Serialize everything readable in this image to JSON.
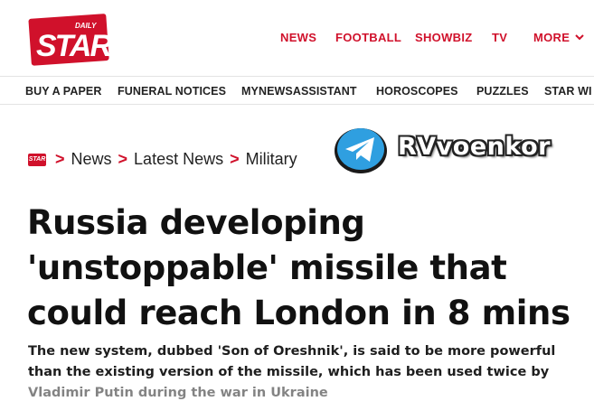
{
  "brand": {
    "logo_top": "DAILY",
    "logo_main": "STAR",
    "accent": "#d0112b"
  },
  "main_nav": {
    "news": "NEWS",
    "football": "FOOTBALL",
    "showbiz": "SHOWBIZ",
    "tv": "TV",
    "more": "MORE"
  },
  "sub_nav": [
    "BUY A PAPER",
    "FUNERAL NOTICES",
    "MYNEWSASSISTANT",
    "HOROSCOPES",
    "PUZZLES",
    "STAR WI"
  ],
  "breadcrumb": {
    "items": [
      "News",
      "Latest News",
      "Military"
    ],
    "separator": ">"
  },
  "watermark": {
    "icon": "telegram-icon",
    "label": "RVvoenkor"
  },
  "article": {
    "headline_lines": [
      "Russia developing",
      "'unstoppable' missile that",
      "could reach London in 8 mins"
    ],
    "standfirst_lines": [
      "The new system, dubbed 'Son of Oreshnik', is said to be more powerful",
      "than the existing version of the missile, which has been used twice by",
      "Vladimir Putin during the war in Ukraine"
    ]
  }
}
